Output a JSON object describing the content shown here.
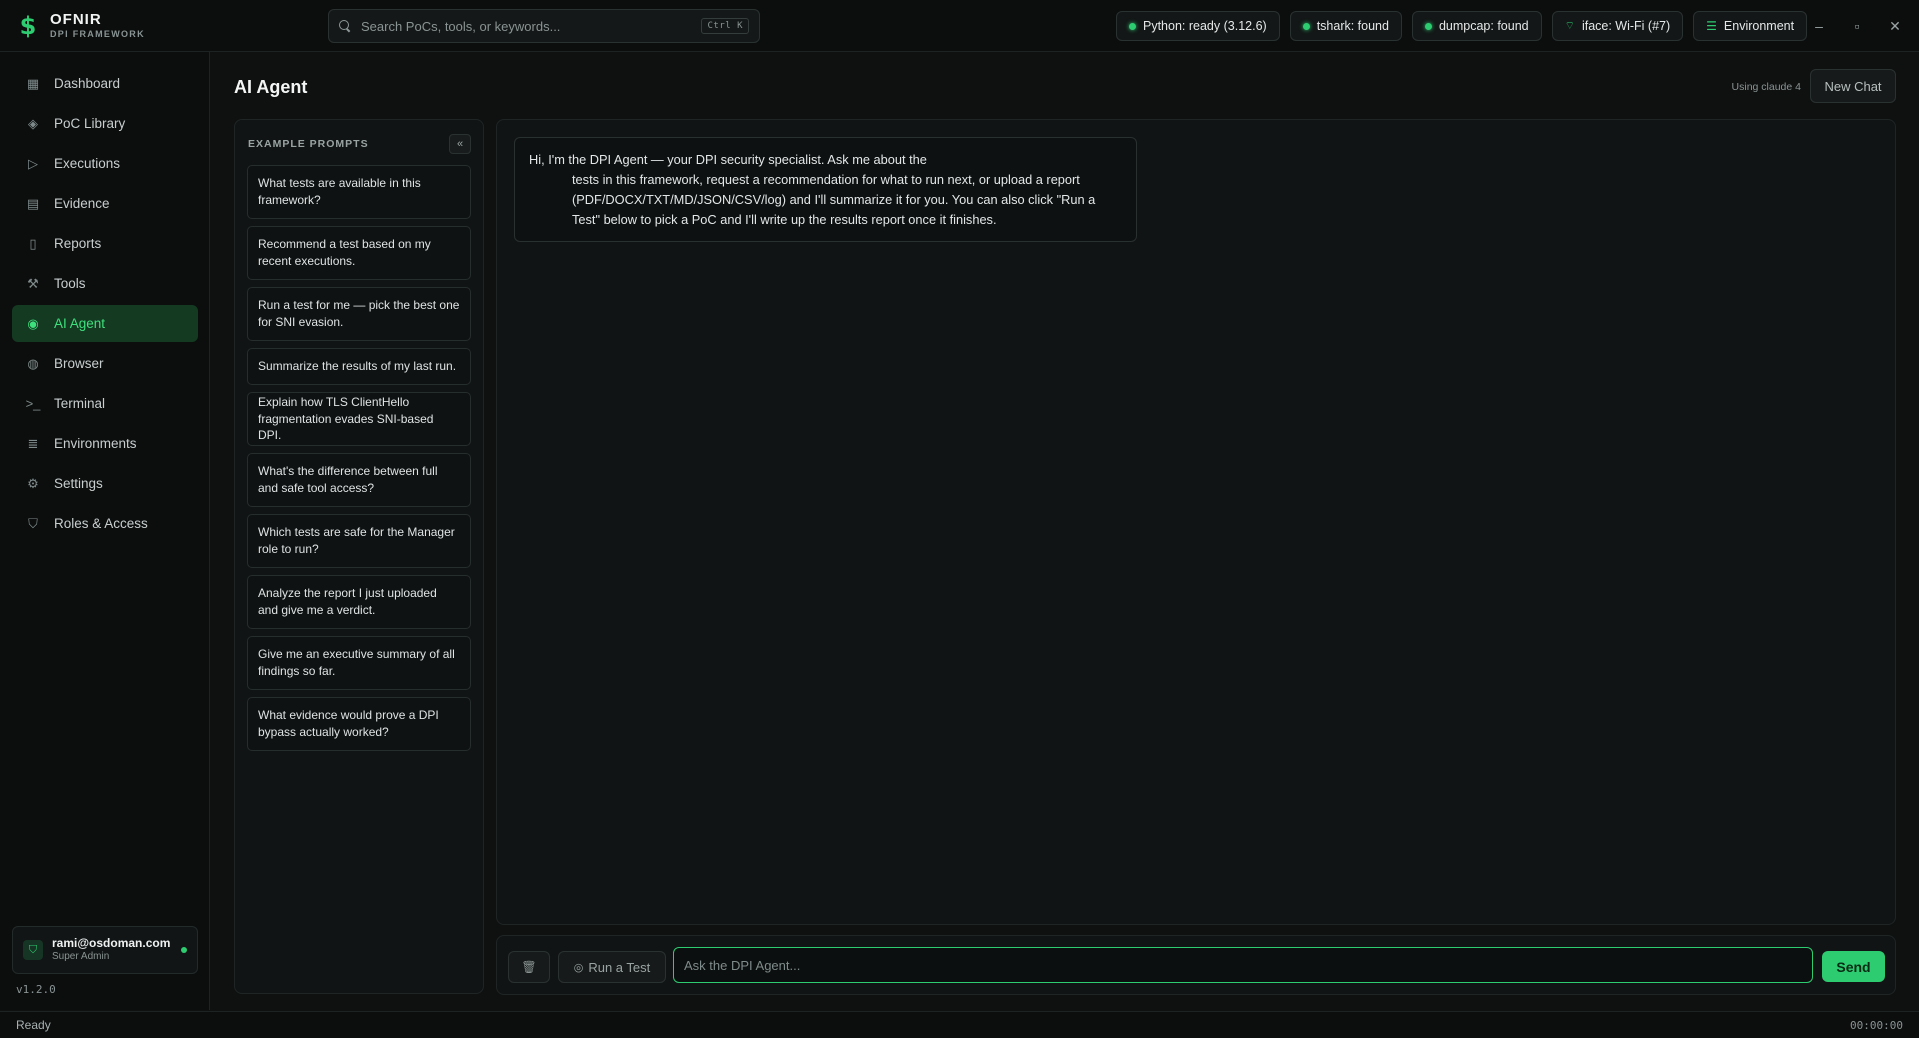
{
  "brand": {
    "name": "OFNIR",
    "subtitle": "DPI FRAMEWORK",
    "logo_glyph": "$"
  },
  "search": {
    "placeholder": "Search PoCs, tools, or keywords...",
    "shortcut": "Ctrl K"
  },
  "status_pills": [
    {
      "label": "Python: ready (3.12.6)",
      "icon": "status-dot"
    },
    {
      "label": "tshark: found",
      "icon": "status-dot"
    },
    {
      "label": "dumpcap: found",
      "icon": "status-dot"
    },
    {
      "label": "iface: Wi-Fi (#7)",
      "icon": "wifi-icon"
    },
    {
      "label": "Environment",
      "icon": "sliders-icon"
    }
  ],
  "window_controls": {
    "minimize": "–",
    "maximize": "▫",
    "close": "✕"
  },
  "sidebar": {
    "items": [
      {
        "label": "Dashboard",
        "icon": "grid-icon",
        "glyph": "▦"
      },
      {
        "label": "PoC Library",
        "icon": "layers-icon",
        "glyph": "◈"
      },
      {
        "label": "Executions",
        "icon": "play-circle-icon",
        "glyph": "▷"
      },
      {
        "label": "Evidence",
        "icon": "archive-icon",
        "glyph": "▤"
      },
      {
        "label": "Reports",
        "icon": "file-icon",
        "glyph": "▯"
      },
      {
        "label": "Tools",
        "icon": "wrench-icon",
        "glyph": "⚒"
      },
      {
        "label": "AI Agent",
        "icon": "robot-icon",
        "glyph": "◉",
        "active": true
      },
      {
        "label": "Browser",
        "icon": "globe-icon",
        "glyph": "◍"
      },
      {
        "label": "Terminal",
        "icon": "terminal-icon",
        "glyph": ">_"
      },
      {
        "label": "Environments",
        "icon": "server-icon",
        "glyph": "≣"
      },
      {
        "label": "Settings",
        "icon": "gear-icon",
        "glyph": "⚙"
      },
      {
        "label": "Roles & Access",
        "icon": "shield-icon",
        "glyph": "⛉"
      }
    ],
    "user": {
      "email": "rami@osdoman.com",
      "role": "Super Admin"
    },
    "version": "v1.2.0"
  },
  "main": {
    "title": "AI Agent",
    "model_info": "Using claude 4",
    "new_chat_label": "New Chat",
    "prompts_header": "EXAMPLE PROMPTS",
    "collapse_glyph": "«",
    "prompts": [
      "What tests are available in this framework?",
      "Recommend a test based on my recent executions.",
      "Run a test for me — pick the best one for SNI evasion.",
      "Summarize the results of my last run.",
      "Explain how TLS ClientHello fragmentation evades SNI-based DPI.",
      "What's the difference between full and safe tool access?",
      "Which tests are safe for the Manager role to run?",
      "Analyze the report I just uploaded and give me a verdict.",
      "Give me an executive summary of all findings so far.",
      "What evidence would prove a DPI bypass actually worked?"
    ],
    "agent_message": {
      "first_line": "Hi, I'm the DPI Agent — your DPI security specialist. Ask me about the",
      "rest": "tests in this framework, request a recommendation for what to run next, or upload a report (PDF/DOCX/TXT/MD/JSON/CSV/log) and I'll summarize it for you. You can also click \"Run a Test\" below to pick a PoC and I'll write up the results report once it finishes."
    },
    "composer": {
      "run_test_label": "Run a Test",
      "input_placeholder": "Ask the DPI Agent...",
      "send_label": "Send"
    }
  },
  "statusbar": {
    "status": "Ready",
    "timer": "00:00:00"
  },
  "colors": {
    "accent": "#2ecc71",
    "background": "#0f1111",
    "panel": "#111414"
  }
}
